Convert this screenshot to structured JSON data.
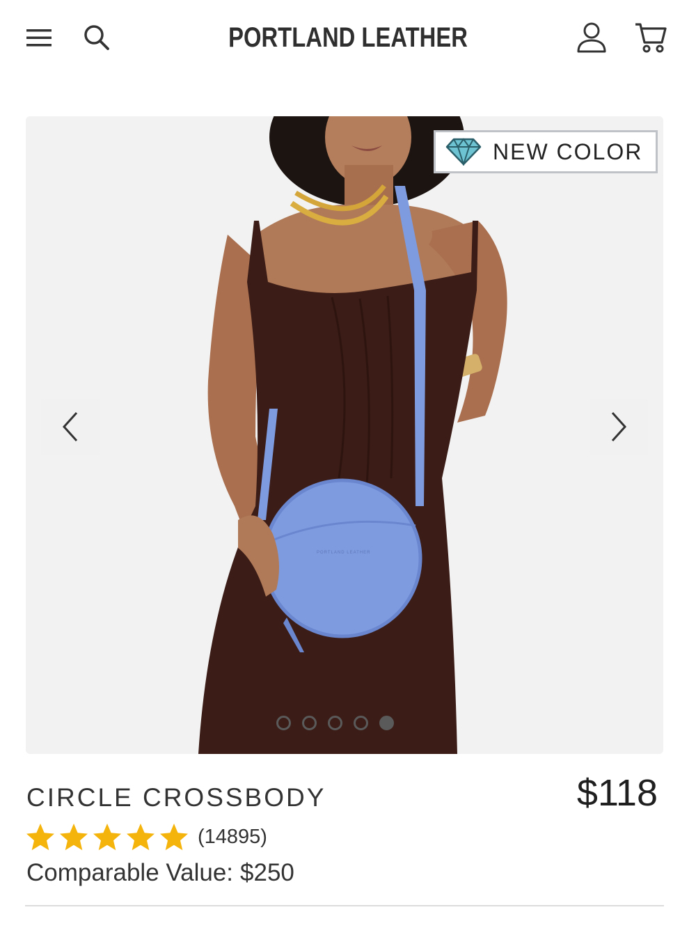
{
  "header": {
    "brand": "PORTLAND LEATHER",
    "menu_icon": "hamburger-icon",
    "search_icon": "search-icon",
    "account_icon": "user-icon",
    "cart_icon": "cart-icon"
  },
  "gallery": {
    "badge": {
      "icon": "diamond-icon",
      "label": "NEW COLOR"
    },
    "bag_imprint": "PORTLAND LEATHER",
    "slides_total": 5,
    "active_slide": 5,
    "prev_icon": "chevron-left-icon",
    "next_icon": "chevron-right-icon"
  },
  "product": {
    "title": "CIRCLE CROSSBODY",
    "price": "$118",
    "rating": 5,
    "review_count": "(14895)",
    "comparable_label": "Comparable Value:",
    "comparable_value": "$250"
  },
  "colors": {
    "bag": "#7f9be0",
    "dress": "#3b1c16",
    "skin": "#b07a58",
    "star": "#f5b40b",
    "badge_diamond": "#6ec3d2"
  }
}
